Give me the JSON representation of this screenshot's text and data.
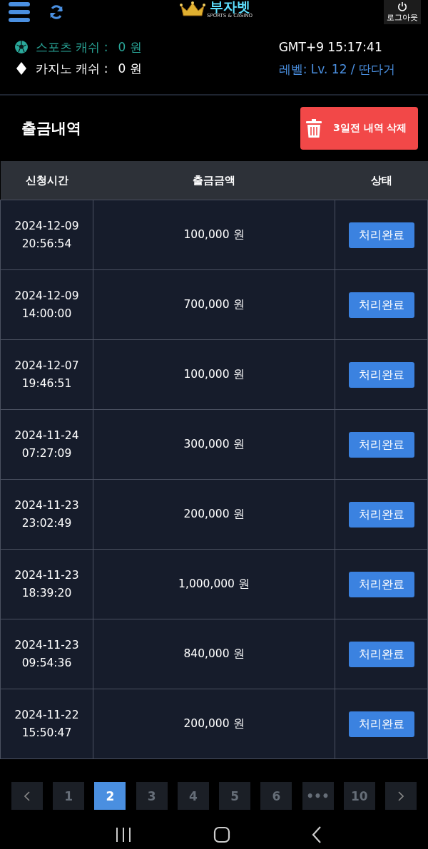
{
  "header": {
    "logo": {
      "title": "부자벳",
      "subtitle": "SPORTS & CASINO"
    },
    "logout": "로그아웃"
  },
  "wallet": [
    {
      "kind": "sports",
      "label": "스포츠 캐쉬 :",
      "value": "0 원"
    },
    {
      "kind": "casino",
      "label": "카지노 캐쉬 :",
      "value": "0 원"
    }
  ],
  "clock": "GMT+9 15:17:41",
  "level": "레벨: Lv. 12 / 딴다거",
  "page_title": "출금내역",
  "delete_button": "3일전 내역 삭제",
  "table": {
    "columns": [
      "신청시간",
      "출금금액",
      "상태"
    ],
    "rows": [
      {
        "date": "2024-12-09",
        "time": "20:56:54",
        "amount": "100,000 원",
        "status": "처리완료"
      },
      {
        "date": "2024-12-09",
        "time": "14:00:00",
        "amount": "700,000 원",
        "status": "처리완료"
      },
      {
        "date": "2024-12-07",
        "time": "19:46:51",
        "amount": "100,000 원",
        "status": "처리완료"
      },
      {
        "date": "2024-11-24",
        "time": "07:27:09",
        "amount": "300,000 원",
        "status": "처리완료"
      },
      {
        "date": "2024-11-23",
        "time": "23:02:49",
        "amount": "200,000 원",
        "status": "처리완료"
      },
      {
        "date": "2024-11-23",
        "time": "18:39:20",
        "amount": "1,000,000 원",
        "status": "처리완료"
      },
      {
        "date": "2024-11-23",
        "time": "09:54:36",
        "amount": "840,000 원",
        "status": "처리완료"
      },
      {
        "date": "2024-11-22",
        "time": "15:50:47",
        "amount": "200,000 원",
        "status": "처리완료"
      }
    ]
  },
  "pagination": [
    {
      "kind": "prev"
    },
    {
      "kind": "page",
      "label": "1",
      "selected": false
    },
    {
      "kind": "page",
      "label": "2",
      "selected": true
    },
    {
      "kind": "page",
      "label": "3",
      "selected": false
    },
    {
      "kind": "page",
      "label": "4",
      "selected": false
    },
    {
      "kind": "page",
      "label": "5",
      "selected": false
    },
    {
      "kind": "page",
      "label": "6",
      "selected": false
    },
    {
      "kind": "page",
      "label": "•••",
      "selected": false
    },
    {
      "kind": "page",
      "label": "10",
      "selected": false
    },
    {
      "kind": "next"
    }
  ]
}
